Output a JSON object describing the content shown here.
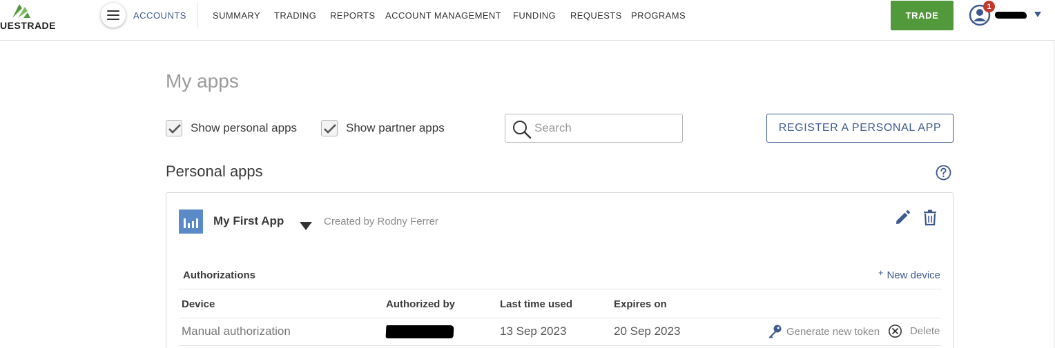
{
  "brand": {
    "logo_text": "UESTRADE"
  },
  "topnav": {
    "accounts_label": "ACCOUNTS",
    "items": [
      "SUMMARY",
      "TRADING",
      "REPORTS",
      "ACCOUNT MANAGEMENT",
      "FUNDING",
      "REQUESTS",
      "PROGRAMS"
    ],
    "trade_label": "TRADE",
    "notification_count": "1"
  },
  "page": {
    "title": "My apps",
    "filters": {
      "personal_label": "Show personal apps",
      "personal_checked": true,
      "partner_label": "Show partner apps",
      "partner_checked": true
    },
    "search": {
      "placeholder": "Search",
      "value": ""
    },
    "register_label": "REGISTER A PERSONAL APP",
    "section_title": "Personal apps"
  },
  "app": {
    "name": "My First App",
    "created_by": "Created by Rodny Ferrer",
    "authorizations_label": "Authorizations",
    "new_device_label": "New device",
    "new_device_plus": "+",
    "columns": [
      "Device",
      "Authorized by",
      "Last time used",
      "Expires on"
    ],
    "rows": [
      {
        "device": "Manual authorization",
        "authorized_by_redacted": true,
        "last_used": "13 Sep 2023",
        "expires_on": "20 Sep 2023",
        "generate_label": "Generate new token",
        "delete_label": "Delete"
      }
    ]
  },
  "colors": {
    "accent": "#3d5a8f",
    "trade": "#52993b",
    "badge": "#c0392b",
    "app_icon": "#5b8ac8"
  },
  "icons": [
    "hamburger-icon",
    "user-icon",
    "search-icon",
    "help-icon",
    "app-chart-icon",
    "pencil-icon",
    "trash-icon",
    "key-icon",
    "close-circle-icon",
    "checkmark-icon"
  ]
}
